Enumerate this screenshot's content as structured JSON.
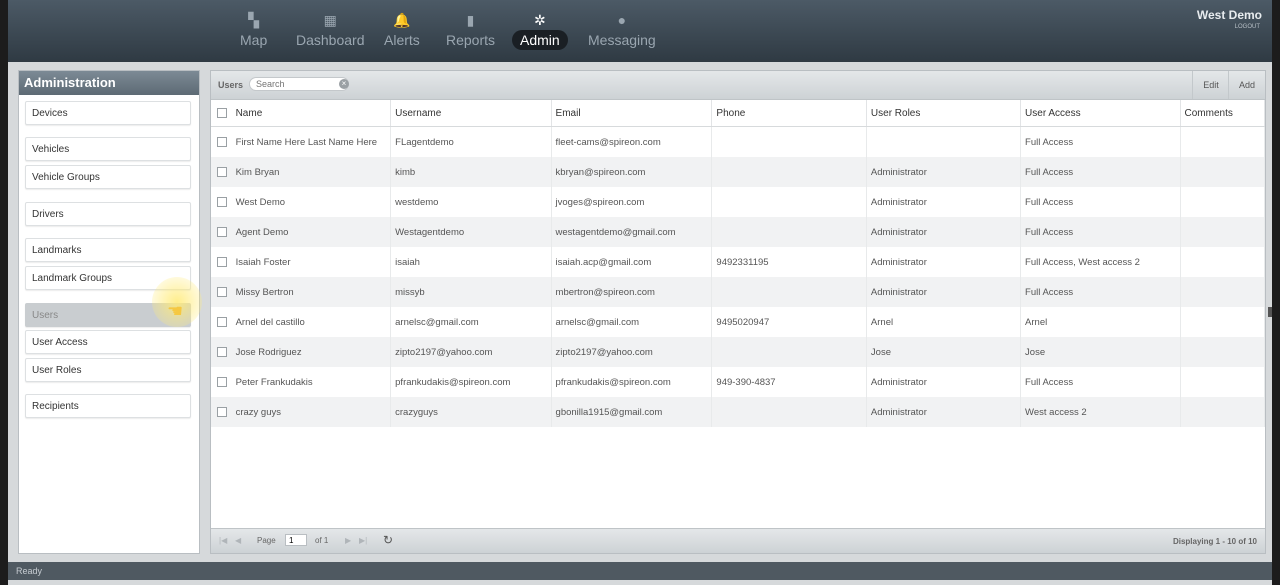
{
  "nav": {
    "items": [
      {
        "label": "Map",
        "icon": "map-icon",
        "glyph": "▚"
      },
      {
        "label": "Dashboard",
        "icon": "dashboard-icon",
        "glyph": "▦"
      },
      {
        "label": "Alerts",
        "icon": "bell-icon",
        "glyph": "🔔"
      },
      {
        "label": "Reports",
        "icon": "bar-chart-icon",
        "glyph": "▮"
      },
      {
        "label": "Admin",
        "icon": "gear-icon",
        "glyph": "✲"
      },
      {
        "label": "Messaging",
        "icon": "chat-icon",
        "glyph": "●"
      }
    ],
    "active": "Admin"
  },
  "user": {
    "name": "West Demo",
    "logout": "LOGOUT"
  },
  "sidebar": {
    "title": "Administration",
    "items": [
      {
        "label": "Devices"
      },
      {
        "label": "Vehicles"
      },
      {
        "label": "Vehicle Groups"
      },
      {
        "label": "Drivers"
      },
      {
        "label": "Landmarks"
      },
      {
        "label": "Landmark Groups"
      },
      {
        "label": "Users"
      },
      {
        "label": "User Access"
      },
      {
        "label": "User Roles"
      },
      {
        "label": "Recipients"
      }
    ],
    "active": "Users"
  },
  "toolbar": {
    "title": "Users",
    "search_placeholder": "Search",
    "clear": "×",
    "edit": "Edit",
    "add": "Add"
  },
  "table": {
    "columns": [
      "Name",
      "Username",
      "Email",
      "Phone",
      "User Roles",
      "User Access",
      "Comments"
    ],
    "rows": [
      [
        "First Name Here Last Name Here",
        "FLagentdemo",
        "fleet-cams@spireon.com",
        "",
        "",
        "Full Access",
        ""
      ],
      [
        "Kim Bryan",
        "kimb",
        "kbryan@spireon.com",
        "",
        "Administrator",
        "Full Access",
        ""
      ],
      [
        "West Demo",
        "westdemo",
        "jvoges@spireon.com",
        "",
        "Administrator",
        "Full Access",
        ""
      ],
      [
        "Agent Demo",
        "Westagentdemo",
        "westagentdemo@gmail.com",
        "",
        "Administrator",
        "Full Access",
        ""
      ],
      [
        "Isaiah Foster",
        "isaiah",
        "isaiah.acp@gmail.com",
        "9492331195",
        "Administrator",
        "Full Access, West access 2",
        ""
      ],
      [
        "Missy Bertron",
        "missyb",
        "mbertron@spireon.com",
        "",
        "Administrator",
        "Full Access",
        ""
      ],
      [
        "Arnel del castillo",
        "arnelsc@gmail.com",
        "arnelsc@gmail.com",
        "9495020947",
        "Arnel",
        "Arnel",
        ""
      ],
      [
        "Jose Rodriguez",
        "zipto2197@yahoo.com",
        "zipto2197@yahoo.com",
        "",
        "Jose",
        "Jose",
        ""
      ],
      [
        "Peter Frankudakis",
        "pfrankudakis@spireon.com",
        "pfrankudakis@spireon.com",
        "949-390-4837",
        "Administrator",
        "Full Access",
        ""
      ],
      [
        "crazy guys",
        "crazyguys",
        "gbonilla1915@gmail.com",
        "",
        "Administrator",
        "West access 2",
        ""
      ]
    ]
  },
  "pager": {
    "page_label": "Page",
    "page_value": "1",
    "of_label": "of 1",
    "display_info": "Displaying 1 - 10 of 10"
  },
  "status": {
    "text": "Ready"
  }
}
